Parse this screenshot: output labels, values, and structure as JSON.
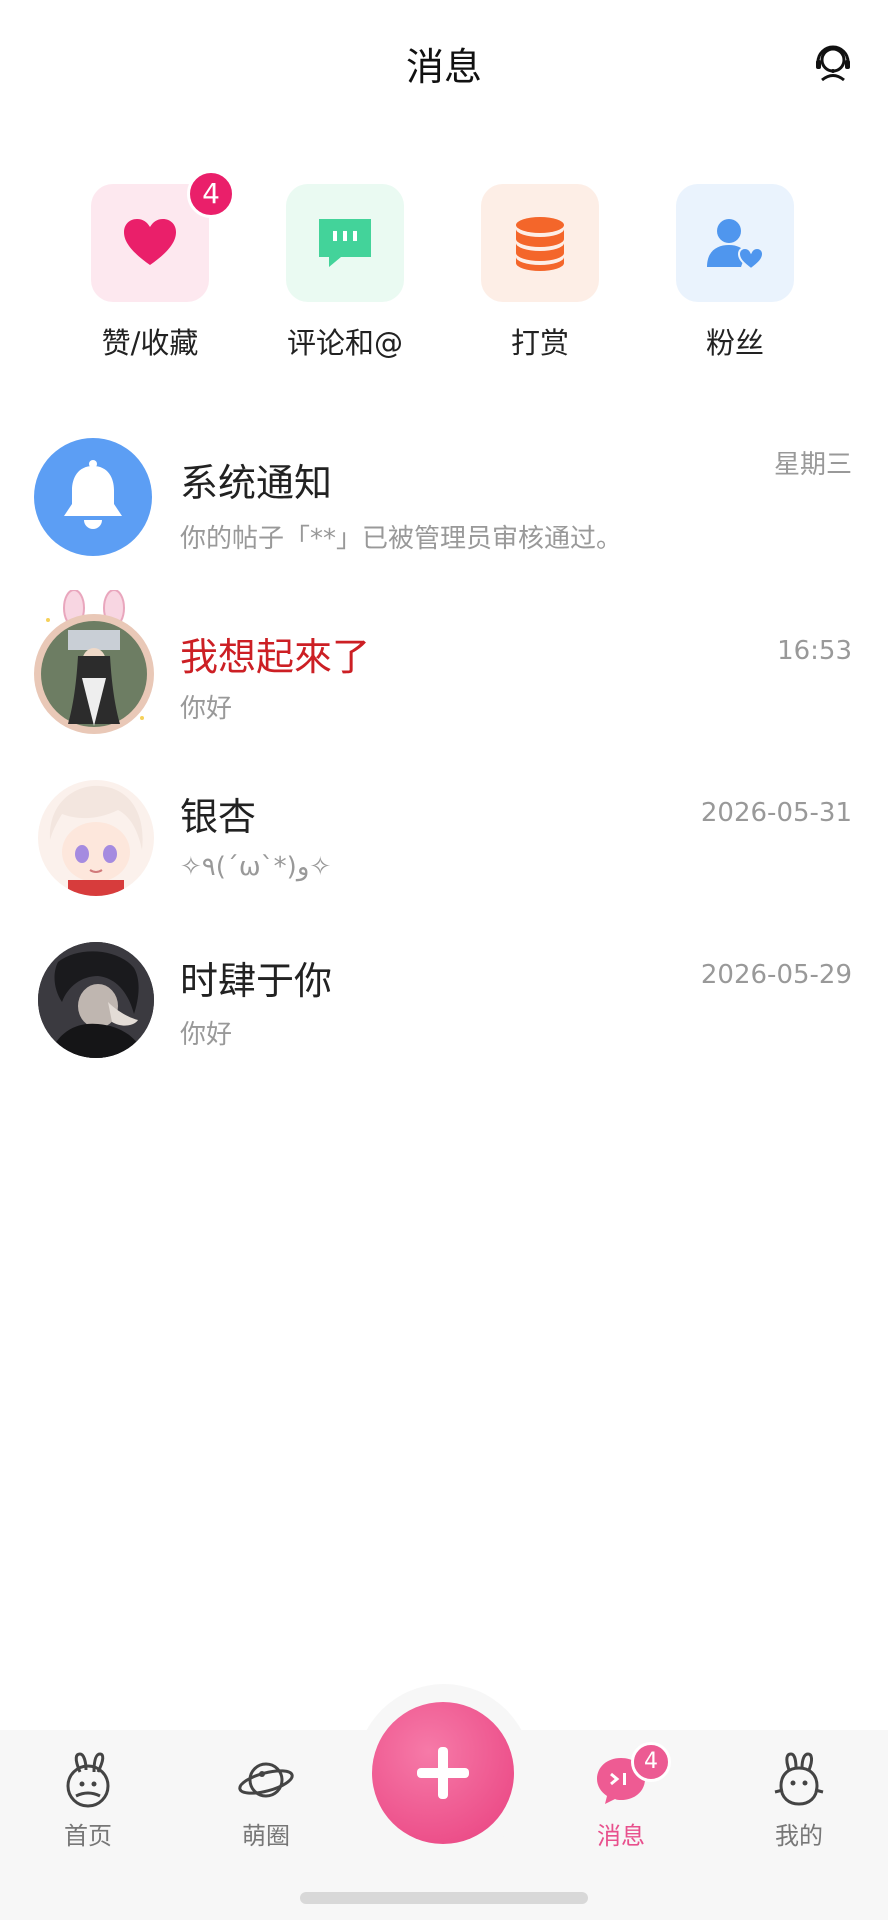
{
  "header": {
    "title": "消息",
    "action_icon": "customer-service-icon"
  },
  "quick_actions": [
    {
      "label": "赞/收藏",
      "icon": "heart-icon",
      "badge": "4",
      "tile_color": "#fde8ef",
      "icon_color": "#ea1f6a"
    },
    {
      "label": "评论和@",
      "icon": "comment-icon",
      "badge": "",
      "tile_color": "#eafaf2",
      "icon_color": "#43d39a"
    },
    {
      "label": "打赏",
      "icon": "coins-icon",
      "badge": "",
      "tile_color": "#fdeee6",
      "icon_color": "#f4662a"
    },
    {
      "label": "粉丝",
      "icon": "fans-icon",
      "badge": "",
      "tile_color": "#eaf3fd",
      "icon_color": "#4f96ee"
    }
  ],
  "conversations": [
    {
      "name": "系统通知",
      "preview": "你的帖子「**」已被管理员审核通过。",
      "time": "星期三",
      "avatar": "bell-icon",
      "name_color": "#222222"
    },
    {
      "name": "我想起來了",
      "preview": "你好",
      "time": "16:53",
      "avatar": "user-avatar-bunny-frame",
      "name_color": "#cc1f24"
    },
    {
      "name": "银杏",
      "preview": "✧٩(ˊωˋ*)و✧",
      "time": "2026-05-31",
      "avatar": "user-avatar-anime",
      "name_color": "#222222"
    },
    {
      "name": "时肆于你",
      "preview": "你好",
      "time": "2026-05-29",
      "avatar": "user-avatar-dark",
      "name_color": "#222222"
    }
  ],
  "tabbar": {
    "tabs": [
      {
        "label": "首页",
        "icon": "bunny-home-icon",
        "active": false
      },
      {
        "label": "萌圈",
        "icon": "planet-icon",
        "active": false
      },
      {
        "label": "消息",
        "icon": "message-icon",
        "active": true,
        "badge": "4"
      },
      {
        "label": "我的",
        "icon": "bunny-profile-icon",
        "active": false
      }
    ],
    "center_button": "add-icon",
    "accent": "#e8508d"
  }
}
